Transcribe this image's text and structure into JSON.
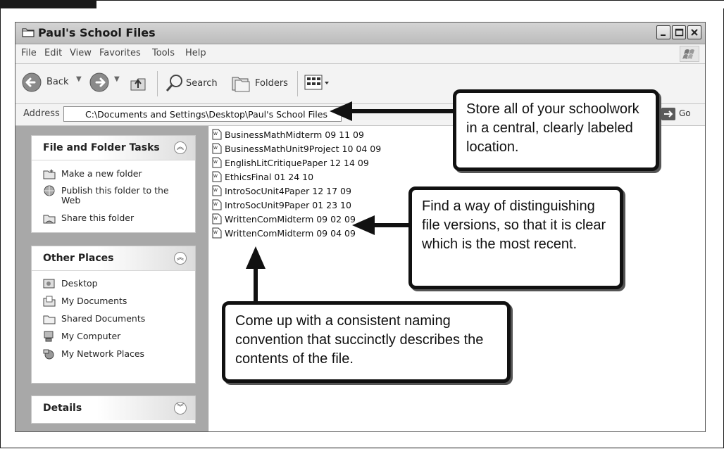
{
  "window": {
    "title": "Paul's School Files",
    "controls": [
      "minimize",
      "maximize",
      "close"
    ]
  },
  "menubar": {
    "items": [
      "File",
      "Edit",
      "View",
      "Favorites",
      "Tools",
      "Help"
    ]
  },
  "toolbar": {
    "back_label": "Back",
    "search_label": "Search",
    "folders_label": "Folders"
  },
  "address": {
    "label": "Address",
    "value": "C:\\Documents and Settings\\Desktop\\Paul's School Files",
    "go_label": "Go"
  },
  "left_pane": {
    "file_tasks": {
      "title": "File and Folder Tasks",
      "items": [
        "Make a new folder",
        "Publish this folder to the Web",
        "Share this folder"
      ]
    },
    "other_places": {
      "title": "Other Places",
      "items": [
        "Desktop",
        "My Documents",
        "Shared Documents",
        "My Computer",
        "My Network Places"
      ]
    },
    "details": {
      "title": "Details"
    }
  },
  "files": [
    "BusinessMathMidterm 09 11 09",
    "BusinessMathUnit9Project 10 04 09",
    "EnglishLitCritiquePaper 12 14 09",
    "EthicsFinal 01 24 10",
    "IntroSocUnit4Paper 12 17 09",
    "IntroSocUnit9Paper 01 23 10",
    "WrittenComMidterm 09 02 09",
    "WrittenComMidterm 09 04 09"
  ],
  "callouts": {
    "location": "Store all of your schoolwork in a central, clearly labeled location.",
    "versions": "Find a way of distinguishing file versions, so that it is clear which is the most recent.",
    "naming": "Come up with a consistent naming convention that succinctly describes the contents of the file."
  }
}
